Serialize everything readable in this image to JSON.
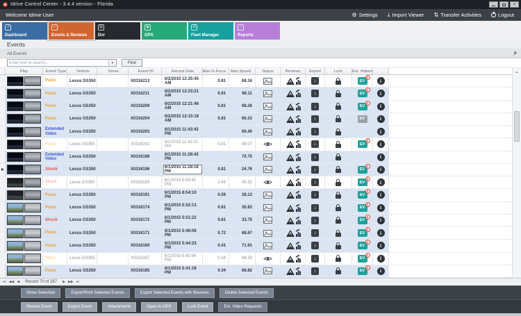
{
  "window": {
    "title": "Idrive Control Center - 3.4.4 version - Florida"
  },
  "menubar": {
    "welcome": "Welcome Idrive User",
    "actions": [
      {
        "label": "Settings",
        "icon": "gear-icon"
      },
      {
        "label": "Import Viewer",
        "icon": "download-icon"
      },
      {
        "label": "Transfer Activities",
        "icon": "transfer-icon"
      },
      {
        "label": "Logout",
        "icon": "power-icon"
      }
    ]
  },
  "tabs": [
    {
      "label": "Dashboard",
      "color": "#3b6da3",
      "selected": false
    },
    {
      "label": "Events & Reviews",
      "color": "#d06531",
      "selected": true
    },
    {
      "label": "Dvr",
      "color": "#26292e",
      "selected": false
    },
    {
      "label": "GPS",
      "color": "#27a879",
      "selected": false
    },
    {
      "label": "Fleet Manager",
      "color": "#17a09d",
      "selected": false
    },
    {
      "label": "Reports",
      "color": "#b77fd9",
      "selected": false
    }
  ],
  "page": {
    "title": "Events",
    "panel_title": "All Events"
  },
  "search": {
    "placeholder": "Enter text to search...",
    "find_label": "Find"
  },
  "table": {
    "ev_label": "EV",
    "columns": [
      "Play",
      "Event Type",
      "Vehicle",
      "Driver",
      "Event ID",
      "Record Date",
      "Max G-Force",
      "Max Speed",
      "Status",
      "Reviews",
      "Export",
      "Lock",
      "Ext. Videos"
    ],
    "rows": [
      {
        "event_type": "Panic",
        "type": "panic",
        "viewed": false,
        "vehicle": "Lexus GS350",
        "driver": "",
        "event_id": "X0316213",
        "record_date": "6/2/2015 12:25:45 AM",
        "g_force": "0.81",
        "speed": "68.16",
        "ev": "badge",
        "ev_count": "2",
        "shaded": false,
        "current": false,
        "focused": false,
        "thumb": "night"
      },
      {
        "event_type": "Panic",
        "type": "panic",
        "viewed": false,
        "vehicle": "Lexus GS350",
        "driver": "",
        "event_id": "X0316211",
        "record_date": "6/2/2015 12:23:21 AM",
        "g_force": "0.81",
        "speed": "66.11",
        "ev": "badge",
        "ev_count": "2",
        "shaded": true,
        "current": false,
        "focused": false,
        "thumb": "night"
      },
      {
        "event_type": "Panic",
        "type": "panic",
        "viewed": false,
        "vehicle": "Lexus GS350",
        "driver": "",
        "event_id": "X0316209",
        "record_date": "6/2/2015 12:21:46 AM",
        "g_force": "0.81",
        "speed": "68.26",
        "ev": "badge",
        "ev_count": "2",
        "shaded": true,
        "current": false,
        "focused": false,
        "thumb": "night"
      },
      {
        "event_type": "Panic",
        "type": "panic",
        "viewed": false,
        "vehicle": "Lexus GS350",
        "driver": "",
        "event_id": "X0316204",
        "record_date": "6/2/2015 12:15:18 AM",
        "g_force": "0.81",
        "speed": "66.33",
        "ev": "gray",
        "ev_count": "",
        "shaded": true,
        "current": false,
        "focused": false,
        "thumb": "night"
      },
      {
        "event_type": "Extended Video",
        "type": "extended",
        "viewed": false,
        "vehicle": "Lexus GS350",
        "driver": "",
        "event_id": "X0316203",
        "record_date": "6/1/2015 11:43:42 PM",
        "g_force": "",
        "speed": "69.40",
        "ev": "none",
        "ev_count": "",
        "shaded": true,
        "current": false,
        "focused": false,
        "thumb": "night"
      },
      {
        "event_type": "Panic",
        "type": "panic",
        "viewed": true,
        "vehicle": "Lexus GS350",
        "driver": "",
        "event_id": "X0316201",
        "record_date": "6/1/2015 11:42:32 PM",
        "g_force": "0.81",
        "speed": "68.07",
        "ev": "badge",
        "ev_count": "2",
        "shaded": false,
        "current": false,
        "focused": false,
        "thumb": "night"
      },
      {
        "event_type": "Extended Video",
        "type": "extended",
        "viewed": false,
        "vehicle": "Lexus GS350",
        "driver": "",
        "event_id": "X0316198",
        "record_date": "6/1/2015 11:28:42 PM",
        "g_force": "",
        "speed": "70.70",
        "ev": "none",
        "ev_count": "",
        "shaded": true,
        "current": false,
        "focused": false,
        "thumb": "night"
      },
      {
        "event_type": "Shock",
        "type": "shock",
        "viewed": false,
        "vehicle": "Lexus GS350",
        "driver": "",
        "event_id": "X0316196",
        "record_date": "6/1/2015 11:28:18 PM",
        "g_force": "0.81",
        "speed": "24.76",
        "ev": "badge",
        "ev_count": "2",
        "shaded": true,
        "current": true,
        "focused": true,
        "thumb": "night"
      },
      {
        "event_type": "Shock",
        "type": "shock",
        "viewed": true,
        "vehicle": "Lexus GS350",
        "driver": "",
        "event_id": "X0316193",
        "record_date": "6/1/2015 8:59:45 PM",
        "g_force": "0.84",
        "speed": "40.31",
        "ev": "badge",
        "ev_count": "2",
        "shaded": false,
        "current": false,
        "focused": false,
        "thumb": "dusk"
      },
      {
        "event_type": "Panic",
        "type": "panic",
        "viewed": false,
        "vehicle": "Lexus GS350",
        "driver": "",
        "event_id": "X0316191",
        "record_date": "6/1/2015 8:54:10 PM",
        "g_force": "0.59",
        "speed": "28.13",
        "ev": "badge",
        "ev_count": "2",
        "shaded": true,
        "current": false,
        "focused": false,
        "thumb": "dusk"
      },
      {
        "event_type": "Panic",
        "type": "panic",
        "viewed": false,
        "vehicle": "Lexus GS350",
        "driver": "",
        "event_id": "X0316174",
        "record_date": "6/1/2015 5:52:13 PM",
        "g_force": "0.81",
        "speed": "30.83",
        "ev": "badge",
        "ev_count": "2",
        "shaded": true,
        "current": false,
        "focused": false,
        "thumb": "day"
      },
      {
        "event_type": "Shock",
        "type": "shock",
        "viewed": false,
        "vehicle": "Lexus GS350",
        "driver": "",
        "event_id": "X0316172",
        "record_date": "6/1/2015 5:51:22 PM",
        "g_force": "0.81",
        "speed": "33.75",
        "ev": "badge",
        "ev_count": "2",
        "shaded": true,
        "current": false,
        "focused": false,
        "thumb": "day"
      },
      {
        "event_type": "Panic",
        "type": "panic",
        "viewed": false,
        "vehicle": "Lexus GS350",
        "driver": "",
        "event_id": "X0316171",
        "record_date": "6/1/2015 5:46:06 PM",
        "g_force": "0.72",
        "speed": "68.67",
        "ev": "badge",
        "ev_count": "2",
        "shaded": true,
        "current": false,
        "focused": false,
        "thumb": "day"
      },
      {
        "event_type": "Panic",
        "type": "panic",
        "viewed": false,
        "vehicle": "Lexus GS350",
        "driver": "",
        "event_id": "X0316169",
        "record_date": "6/1/2015 5:44:23 PM",
        "g_force": "0.41",
        "speed": "71.91",
        "ev": "badge",
        "ev_count": "2",
        "shaded": true,
        "current": false,
        "focused": false,
        "thumb": "day"
      },
      {
        "event_type": "Panic",
        "type": "panic",
        "viewed": true,
        "vehicle": "Lexus GS350",
        "driver": "",
        "event_id": "X0316167",
        "record_date": "6/1/2015 5:43:56 PM",
        "g_force": "0.34",
        "speed": "68.29",
        "ev": "badge",
        "ev_count": "2",
        "shaded": false,
        "current": false,
        "focused": false,
        "thumb": "day"
      },
      {
        "event_type": "Panic",
        "type": "panic",
        "viewed": false,
        "vehicle": "Lexus GS350",
        "driver": "",
        "event_id": "X0316165",
        "record_date": "6/1/2015 5:41:18 PM",
        "g_force": "0.34",
        "speed": "68.82",
        "ev": "badge",
        "ev_count": "2",
        "shaded": true,
        "current": false,
        "focused": false,
        "thumb": "day"
      }
    ]
  },
  "pager": {
    "text": "Record 70 of 287"
  },
  "actions_primary": [
    "Show Selection",
    "Export/Print Selected Events",
    "Export Selected Events with Reviews",
    "Delete Selected  Events"
  ],
  "actions_secondary": [
    "Review Event",
    "Export Event",
    "Attachments",
    "Open in GPS",
    "Lock Event",
    "Ext. Video Requests"
  ]
}
